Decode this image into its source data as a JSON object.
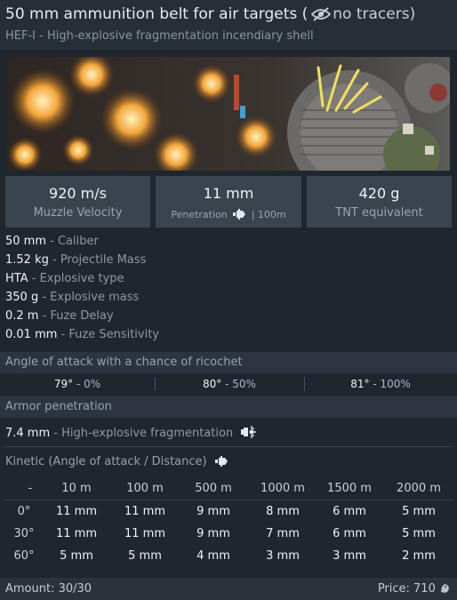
{
  "header": {
    "title": "50 mm ammunition belt for air targets (",
    "tracers": "no tracers)",
    "subtitle": "HEF-I - High-explosive fragmentation incendiary shell"
  },
  "stats": [
    {
      "value": "920 m/s",
      "label": "Muzzle Velocity"
    },
    {
      "value": "11 mm",
      "label": "Penetration",
      "suffix": "| 100m"
    },
    {
      "value": "420 g",
      "label": "TNT equivalent"
    }
  ],
  "properties": [
    {
      "value": "50 mm",
      "label": " - Caliber"
    },
    {
      "value": "1.52 kg",
      "label": " - Projectile Mass"
    },
    {
      "value": "HTA",
      "label": " - Explosive type"
    },
    {
      "value": "350 g",
      "label": " - Explosive mass"
    },
    {
      "value": "0.2 m",
      "label": " - Fuze Delay"
    },
    {
      "value": "0.01 mm",
      "label": " - Fuze Sensitivity"
    }
  ],
  "ricochet": {
    "title": "Angle of attack with a chance of ricochet",
    "items": [
      {
        "angle": "79°",
        "chance": " - 0%"
      },
      {
        "angle": "80°",
        "chance": " - 50%"
      },
      {
        "angle": "81°",
        "chance": " - 100%"
      }
    ]
  },
  "armor": {
    "title": "Armor penetration",
    "hef_value": "7.4 mm",
    "hef_label": " - High-explosive fragmentation"
  },
  "kinetic": {
    "title": "Kinetic (Angle of attack / Distance)",
    "columns": [
      "-",
      "10 m",
      "100 m",
      "500 m",
      "1000 m",
      "1500 m",
      "2000 m"
    ],
    "rows": [
      {
        "angle": "0°",
        "values": [
          "11 mm",
          "11 mm",
          "9 mm",
          "8 mm",
          "6 mm",
          "5 mm"
        ]
      },
      {
        "angle": "30°",
        "values": [
          "11 mm",
          "11 mm",
          "9 mm",
          "7 mm",
          "6 mm",
          "5 mm"
        ]
      },
      {
        "angle": "60°",
        "values": [
          "5 mm",
          "5 mm",
          "4 mm",
          "3 mm",
          "3 mm",
          "2 mm"
        ]
      }
    ]
  },
  "footer": {
    "amount": "Amount: 30/30",
    "price": "Price: 710"
  },
  "icons": {
    "no_tracers": "eye-slash-icon",
    "penetration": "shell-icon",
    "fragmentation": "explosion-icon",
    "currency": "silver-lion-icon"
  }
}
